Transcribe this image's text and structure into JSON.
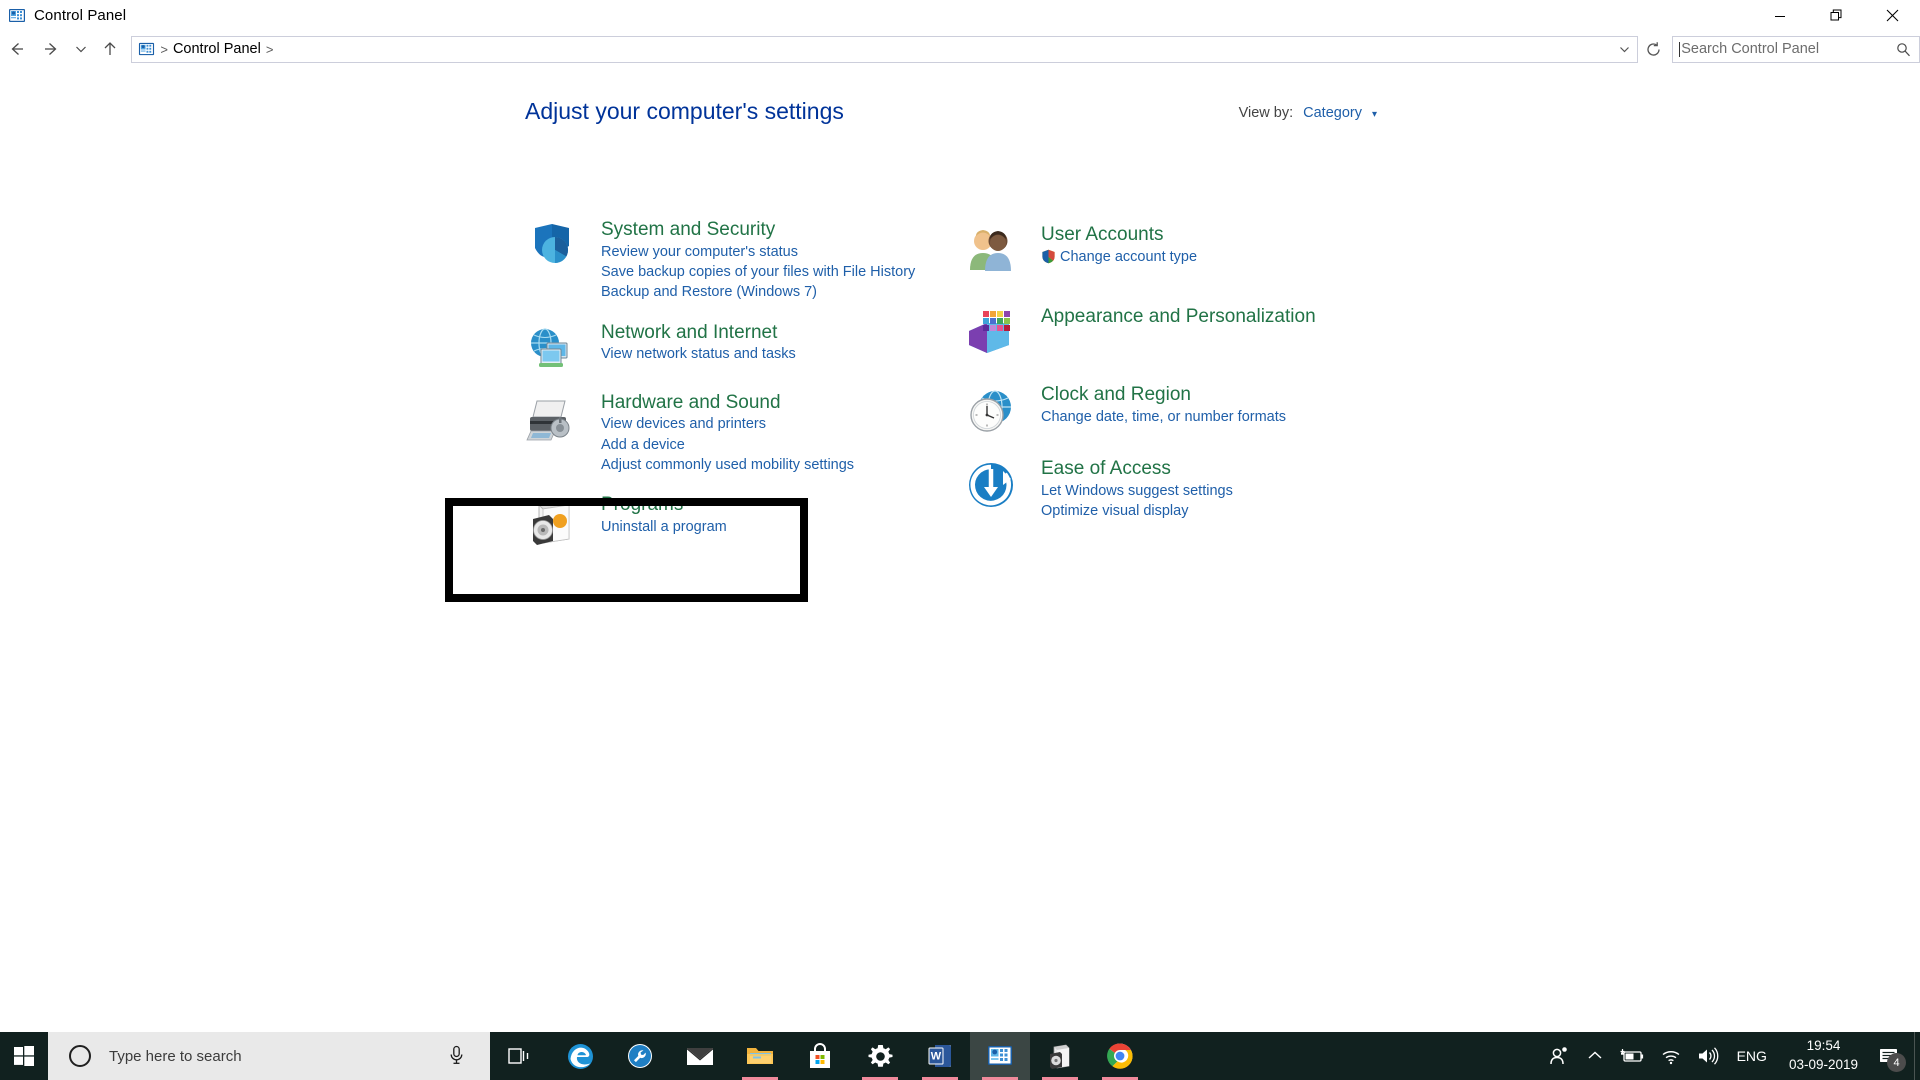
{
  "window": {
    "title": "Control Panel",
    "icon": "control-panel-icon",
    "controls": {
      "minimize": "Minimize",
      "restore": "Restore",
      "close": "Close"
    }
  },
  "navbar": {
    "back": "Back",
    "forward": "Forward",
    "recent": "Recent locations",
    "up": "Up",
    "breadcrumb": [
      "Control Panel"
    ],
    "breadcrumb_separator": ">",
    "address_dropdown": "Previous locations",
    "refresh": "Refresh",
    "search": {
      "placeholder": "Search Control Panel",
      "icon": "search-icon",
      "value": ""
    }
  },
  "main": {
    "page_title": "Adjust your computer's settings",
    "view_by": {
      "label": "View by:",
      "value": "Category",
      "caret": "▾"
    },
    "left_categories": [
      {
        "icon": "shield-chart-icon",
        "title": "System and Security",
        "links": [
          "Review your computer's status",
          "Save backup copies of your files with File History",
          "Backup and Restore (Windows 7)"
        ]
      },
      {
        "icon": "network-globe-icon",
        "title": "Network and Internet",
        "links": [
          "View network status and tasks"
        ]
      },
      {
        "icon": "printer-icon",
        "title": "Hardware and Sound",
        "links": [
          "View devices and printers",
          "Add a device",
          "Adjust commonly used mobility settings"
        ]
      },
      {
        "icon": "programs-box-icon",
        "title": "Programs",
        "links": [
          "Uninstall a program"
        ]
      }
    ],
    "right_categories": [
      {
        "icon": "user-accounts-icon",
        "title": "User Accounts",
        "links": [
          "Change account type"
        ],
        "link_shield": true
      },
      {
        "icon": "appearance-icon",
        "title": "Appearance and Personalization",
        "links": []
      },
      {
        "icon": "clock-globe-icon",
        "title": "Clock and Region",
        "links": [
          "Change date, time, or number formats"
        ]
      },
      {
        "icon": "ease-of-access-icon",
        "title": "Ease of Access",
        "links": [
          "Let Windows suggest settings",
          "Optimize visual display"
        ]
      }
    ],
    "highlight": {
      "target": "Programs",
      "color": "#000000"
    }
  },
  "taskbar": {
    "start": "Start",
    "search": {
      "placeholder": "Type here to search",
      "cortana_icon": "cortana-circle-icon",
      "mic_icon": "microphone-icon"
    },
    "apps": [
      {
        "name": "task-view",
        "label": "Task View",
        "running": false,
        "active": false
      },
      {
        "name": "edge",
        "label": "Microsoft Edge",
        "running": false,
        "active": false
      },
      {
        "name": "repair-tool",
        "label": "Support Assistant",
        "running": false,
        "active": false
      },
      {
        "name": "mail",
        "label": "Mail",
        "running": false,
        "active": false
      },
      {
        "name": "file-explorer",
        "label": "File Explorer",
        "running": true,
        "active": false
      },
      {
        "name": "microsoft-store",
        "label": "Microsoft Store",
        "running": false,
        "active": false
      },
      {
        "name": "settings",
        "label": "Settings",
        "running": true,
        "active": false
      },
      {
        "name": "word",
        "label": "Word",
        "running": true,
        "active": false
      },
      {
        "name": "control-panel",
        "label": "Control Panel",
        "running": true,
        "active": true
      },
      {
        "name": "uninstall-program",
        "label": "Programs and Features",
        "running": true,
        "active": false
      },
      {
        "name": "chrome",
        "label": "Google Chrome",
        "running": true,
        "active": false
      }
    ],
    "tray": {
      "people_icon": "people-icon",
      "overflow_icon": "chevron-up-icon",
      "battery_icon": "battery-charging-icon",
      "network_icon": "wifi-icon",
      "volume_icon": "speaker-icon",
      "language": "ENG",
      "time": "19:54",
      "date": "03-09-2019",
      "notifications_icon": "notification-icon",
      "notifications_count": "4"
    }
  },
  "colors": {
    "title_blue": "#003399",
    "category_green": "#217346",
    "link_blue": "#1f5fa9",
    "taskbar": "#11211f",
    "highlight": "#000000",
    "indicator": "#f08a9b"
  }
}
